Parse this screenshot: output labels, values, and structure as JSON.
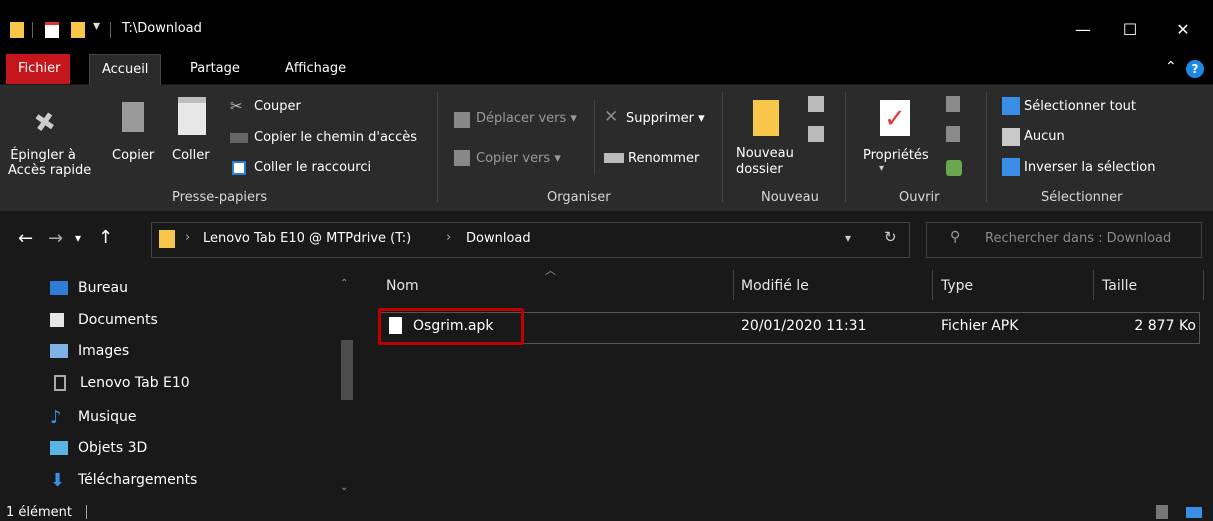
{
  "window": {
    "title": "T:\\Download",
    "controls": {
      "minimize": "—",
      "maximize": "☐",
      "close": "✕"
    }
  },
  "ribbon_tabs": {
    "fichier": "Fichier",
    "accueil": "Accueil",
    "partage": "Partage",
    "affichage": "Affichage"
  },
  "ribbon": {
    "presse_papiers": {
      "epingler_line1": "Épingler à",
      "epingler_line2": "Accès rapide",
      "copier": "Copier",
      "coller": "Coller",
      "couper": "Couper",
      "copier_chemin": "Copier le chemin d'accès",
      "coller_raccourci": "Coller le raccourci",
      "label": "Presse-papiers"
    },
    "organiser": {
      "deplacer": "Déplacer vers",
      "copier_vers": "Copier vers",
      "supprimer": "Supprimer",
      "renommer": "Renommer",
      "label": "Organiser"
    },
    "nouveau": {
      "dossier_line1": "Nouveau",
      "dossier_line2": "dossier",
      "label": "Nouveau"
    },
    "ouvrir": {
      "proprietes": "Propriétés",
      "label": "Ouvrir"
    },
    "selectionner": {
      "tout": "Sélectionner tout",
      "aucun": "Aucun",
      "inverser": "Inverser la sélection",
      "label": "Sélectionner"
    }
  },
  "address": {
    "device": "Lenovo Tab E10 @ MTPdrive (T:)",
    "folder": "Download",
    "search_placeholder": "Rechercher dans : Download"
  },
  "nav_pane": {
    "items": [
      {
        "label": "Bureau",
        "icon": "desktop-icon"
      },
      {
        "label": "Documents",
        "icon": "documents-icon"
      },
      {
        "label": "Images",
        "icon": "images-icon"
      },
      {
        "label": "Lenovo Tab E10",
        "icon": "device-icon"
      },
      {
        "label": "Musique",
        "icon": "music-icon"
      },
      {
        "label": "Objets 3D",
        "icon": "objects3d-icon"
      },
      {
        "label": "Téléchargements",
        "icon": "downloads-icon"
      }
    ]
  },
  "list": {
    "columns": {
      "name": "Nom",
      "modified": "Modifié le",
      "type": "Type",
      "size": "Taille"
    },
    "rows": [
      {
        "name": "Osgrim.apk",
        "modified": "20/01/2020 11:31",
        "type": "Fichier APK",
        "size": "2 877 Ko"
      }
    ]
  },
  "status": {
    "count": "1 élément"
  },
  "colors": {
    "accent_red": "#c4161c",
    "highlight_box": "#c00000",
    "folder_yellow": "#f8c648"
  }
}
